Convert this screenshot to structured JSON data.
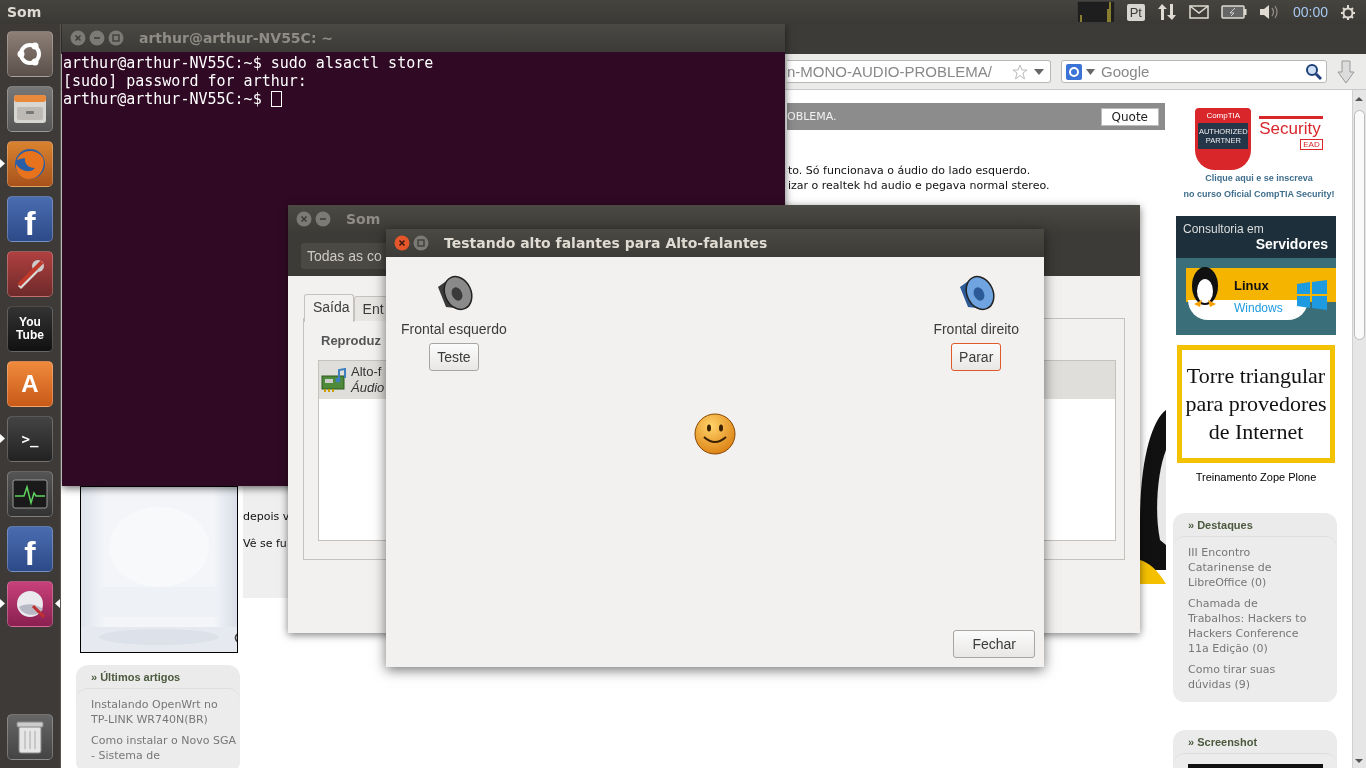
{
  "top_panel": {
    "app_title": "Som",
    "keyboard_layout": "Pt",
    "clock": "00:00"
  },
  "launcher": {
    "items": [
      {
        "kind": "ubuntu",
        "running": false,
        "focused": false
      },
      {
        "kind": "files",
        "running": false,
        "focused": false
      },
      {
        "kind": "firefox",
        "running": true,
        "focused": false
      },
      {
        "kind": "facebook",
        "glyph": "f",
        "running": false,
        "focused": false
      },
      {
        "kind": "settings",
        "running": false,
        "focused": false
      },
      {
        "kind": "video",
        "glyph": "You Tube",
        "running": false,
        "focused": false
      },
      {
        "kind": "store",
        "glyph": "A",
        "running": false,
        "focused": false
      },
      {
        "kind": "terminal",
        "glyph": ">_",
        "running": true,
        "focused": false
      },
      {
        "kind": "monitor",
        "running": false,
        "focused": false
      },
      {
        "kind": "facebook",
        "glyph": "f",
        "running": false,
        "focused": false
      },
      {
        "kind": "ball",
        "running": true,
        "focused": true
      }
    ],
    "trash": {
      "kind": "trash"
    }
  },
  "browser": {
    "url_tail": "n-MONO-AUDIO-PROBLEMA/",
    "search_placeholder": "Google",
    "post": {
      "header": "OBLEMA.",
      "quote_button": "Quote",
      "lines": [
        "to. Só funcionava o áudio do lado esquerdo.",
        "izar o realtek hd audio e pegava normal stereo."
      ]
    },
    "fragments": [
      "depois v",
      "Vê se fu"
    ],
    "comptia_ad": {
      "badge_title": "CompTIA",
      "badge_text": "AUTHORIZED PARTNER",
      "course": "Security",
      "course_tag": "EAD",
      "caption_lines": [
        "Clique aqui e se inscreva",
        "no curso Oficial CompTIA Security!"
      ]
    },
    "server_ad": {
      "line1": "Consultoria em",
      "line2": "Servidores",
      "linux": "Linux",
      "windows": "Windows"
    },
    "tower_ad": {
      "lines": [
        "Torre triangular",
        "para provedores",
        "de Internet"
      ]
    },
    "zope_link": "Treinamento Zope Plone",
    "sidebar_boxes": [
      {
        "title": "» Destaques",
        "items": [
          "III Encontro Catarinense de LibreOffice (0)",
          "Chamada de Trabalhos: Hackers to Hackers Conference 11a Edição (0)",
          "Como tirar suas dúvidas (9)"
        ]
      },
      {
        "title": "» Screenshot"
      }
    ],
    "left_box": {
      "title": "» Últimos artigos",
      "items": [
        "Instalando OpenWrt no TP-LINK WR740N(BR)",
        "Como instalar o Novo SGA - Sistema de"
      ]
    }
  },
  "terminal": {
    "title": "arthur@arthur-NV55C: ~",
    "lines": [
      "arthur@arthur-NV55C:~$ sudo alsactl store",
      "[sudo] password for arthur:",
      "arthur@arthur-NV55C:~$ "
    ]
  },
  "sound_window": {
    "title": "Som",
    "device_combo": "Todas as co",
    "tabs": [
      {
        "label": "Saída",
        "selected": true
      },
      {
        "label": "Ent",
        "selected": false
      }
    ],
    "section": "Reproduz",
    "devices": [
      {
        "name": "Alto-f",
        "description": "Áudio",
        "selected": true
      }
    ]
  },
  "test_dialog": {
    "title": "Testando alto falantes para Alto-falantes",
    "channels": [
      {
        "name": "Frontal esquerdo",
        "button": "Teste",
        "playing": false
      },
      {
        "name": "Frontal direito",
        "button": "Parar",
        "playing": true
      }
    ],
    "close_button": "Fechar"
  }
}
